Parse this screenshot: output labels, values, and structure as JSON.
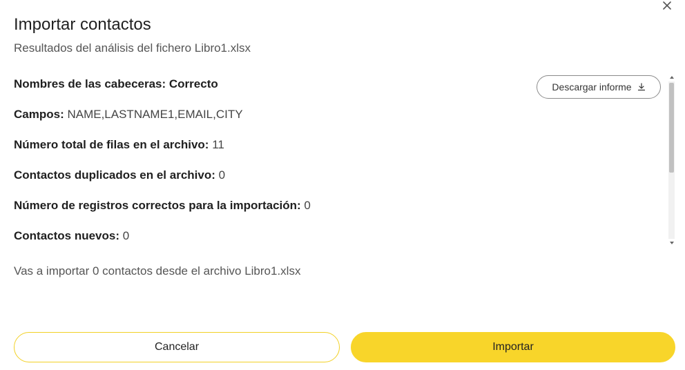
{
  "dialog": {
    "title": "Importar contactos",
    "subtitle": "Resultados del análisis del fichero Libro1.xlsx",
    "close_icon": "close-icon"
  },
  "results": {
    "rows": [
      {
        "label": "Nombres de las cabeceras: Correcto",
        "value": ""
      },
      {
        "label": "Campos:",
        "value": " NAME,LASTNAME1,EMAIL,CITY"
      },
      {
        "label": "Número total de filas en el archivo:",
        "value": " 11"
      },
      {
        "label": "Contactos duplicados en el archivo:",
        "value": " 0"
      },
      {
        "label": "Número de registros correctos para la importación:",
        "value": " 0"
      },
      {
        "label": "Contactos nuevos:",
        "value": " 0"
      }
    ],
    "download_label": "Descargar informe",
    "download_icon": "download-icon"
  },
  "summary": "Vas a importar 0 contactos desde el archivo Libro1.xlsx",
  "actions": {
    "cancel_label": "Cancelar",
    "import_label": "Importar"
  },
  "colors": {
    "accent": "#f8d52a",
    "cancel_border": "#f2d024",
    "text": "#1f1f1f",
    "muted_text": "#555555"
  }
}
